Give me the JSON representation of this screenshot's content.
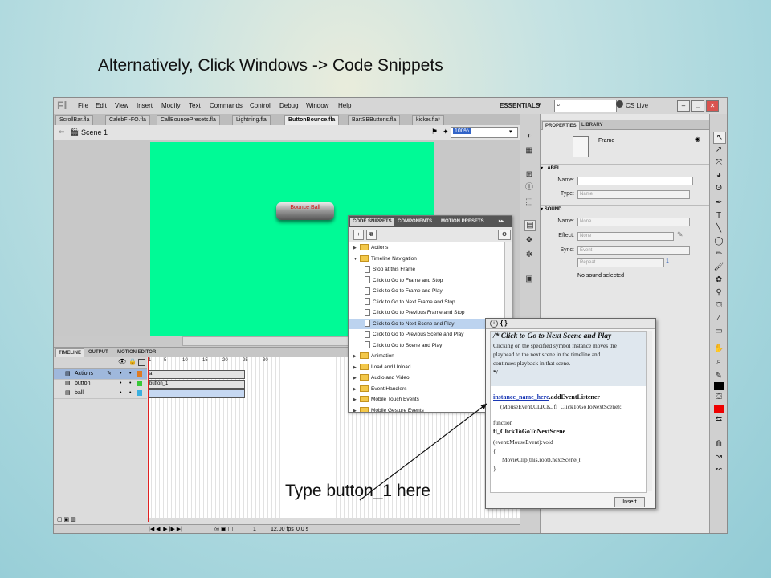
{
  "slide": {
    "headline": "Alternatively, Click Windows -> Code Snippets",
    "annotation": "Type button_1 here"
  },
  "app": {
    "logo": "Fl",
    "menu": [
      "File",
      "Edit",
      "View",
      "Insert",
      "Modify",
      "Text",
      "Commands",
      "Control",
      "Debug",
      "Window",
      "Help"
    ],
    "workspace": "ESSENTIALS",
    "search_value": "",
    "cs_live": "CS Live",
    "window_buttons": [
      "–",
      "□",
      "✕"
    ],
    "doc_tabs": [
      {
        "label": "ScrollBar.fla",
        "active": false
      },
      {
        "label": "CalebFI-FO.fla",
        "active": false
      },
      {
        "label": "CallBouncePresets.fla",
        "active": false
      },
      {
        "label": "Lightning.fla",
        "active": false
      },
      {
        "label": "ButtonBounce.fla",
        "active": true
      },
      {
        "label": "BartSBButtons.fla",
        "active": false
      },
      {
        "label": "kicker.fla*",
        "active": false
      }
    ],
    "scene": "Scene 1",
    "zoom": "100%",
    "stage_button_label": "Bounce Ball",
    "scroll_glyph": "III"
  },
  "timeline": {
    "tabs": [
      "TIMELINE",
      "OUTPUT",
      "MOTION EDITOR"
    ],
    "ruler": [
      "1",
      "5",
      "10",
      "15",
      "20",
      "25",
      "30"
    ],
    "layers": [
      {
        "name": "Actions",
        "selected": true
      },
      {
        "name": "button",
        "selected": false
      },
      {
        "name": "ball",
        "selected": false
      }
    ],
    "button_frame_label": "button_1",
    "action_frame_label": "a",
    "bottom_frame": "1",
    "fps": "12.00 fps",
    "time": "0.0 s"
  },
  "properties": {
    "tabs": [
      "PROPERTIES",
      "LIBRARY"
    ],
    "frame_label": "Frame",
    "section_label": "LABEL",
    "name_label": "Name:",
    "type_label": "Type:",
    "type_value": "Name",
    "section_sound": "SOUND",
    "sound_name_value": "None",
    "effect_label": "Effect:",
    "effect_value": "None",
    "sync_label": "Sync:",
    "sync_value": "Event",
    "repeat_value": "Repeat",
    "repeat_count": "1",
    "no_sound": "No sound selected"
  },
  "code_snippets": {
    "tabs": [
      "CODE SNIPPETS",
      "COMPONENTS",
      "MOTION PRESETS"
    ],
    "tree": [
      {
        "label": "Actions",
        "type": "folder",
        "expanded": false,
        "indent": 0,
        "selected": false
      },
      {
        "label": "Timeline Navigation",
        "type": "folder",
        "expanded": true,
        "indent": 0,
        "selected": false
      },
      {
        "label": "Stop at this Frame",
        "type": "doc",
        "indent": 1,
        "selected": false
      },
      {
        "label": "Click to Go to Frame and Stop",
        "type": "doc",
        "indent": 1,
        "selected": false
      },
      {
        "label": "Click to Go to Frame and Play",
        "type": "doc",
        "indent": 1,
        "selected": false
      },
      {
        "label": "Click to Go to Next Frame and Stop",
        "type": "doc",
        "indent": 1,
        "selected": false
      },
      {
        "label": "Click to Go to Previous Frame and Stop",
        "type": "doc",
        "indent": 1,
        "selected": false
      },
      {
        "label": "Click to Go to Next Scene and Play",
        "type": "doc",
        "indent": 1,
        "selected": true
      },
      {
        "label": "Click to Go to Previous Scene and Play",
        "type": "doc",
        "indent": 1,
        "selected": false
      },
      {
        "label": "Click to Go to Scene and Play",
        "type": "doc",
        "indent": 1,
        "selected": false
      },
      {
        "label": "Animation",
        "type": "folder",
        "expanded": false,
        "indent": 0,
        "selected": false
      },
      {
        "label": "Load and Unload",
        "type": "folder",
        "expanded": false,
        "indent": 0,
        "selected": false
      },
      {
        "label": "Audio and Video",
        "type": "folder",
        "expanded": false,
        "indent": 0,
        "selected": false
      },
      {
        "label": "Event Handlers",
        "type": "folder",
        "expanded": false,
        "indent": 0,
        "selected": false
      },
      {
        "label": "Mobile Touch Events",
        "type": "folder",
        "expanded": false,
        "indent": 0,
        "selected": false
      },
      {
        "label": "Mobile Gesture Events",
        "type": "folder",
        "expanded": false,
        "indent": 0,
        "selected": false
      }
    ]
  },
  "code_popup": {
    "header_icons": "i  { }",
    "title": "/* Click to Go to Next Scene and Play",
    "desc": [
      "Clicking on the specified symbol instance moves the",
      "playhead to the next scene in the timeline and",
      "continues playback in that scene."
    ],
    "close_comment": "*/",
    "instance": "instance_name_here",
    "listener": ".addEventListener",
    "listener_args": "(MouseEvent.CLICK, fl_ClickToGoToNextScene);",
    "function_kw": "function",
    "function_name": "fl_ClickToGoToNextScene",
    "function_sig_open": "(",
    "function_sig": "event:MouseEvent",
    "function_sig_close": "):void",
    "brace_open": "{",
    "body": "MovieClip(this.root).nextScene();",
    "brace_close": "}",
    "insert": "Insert"
  }
}
